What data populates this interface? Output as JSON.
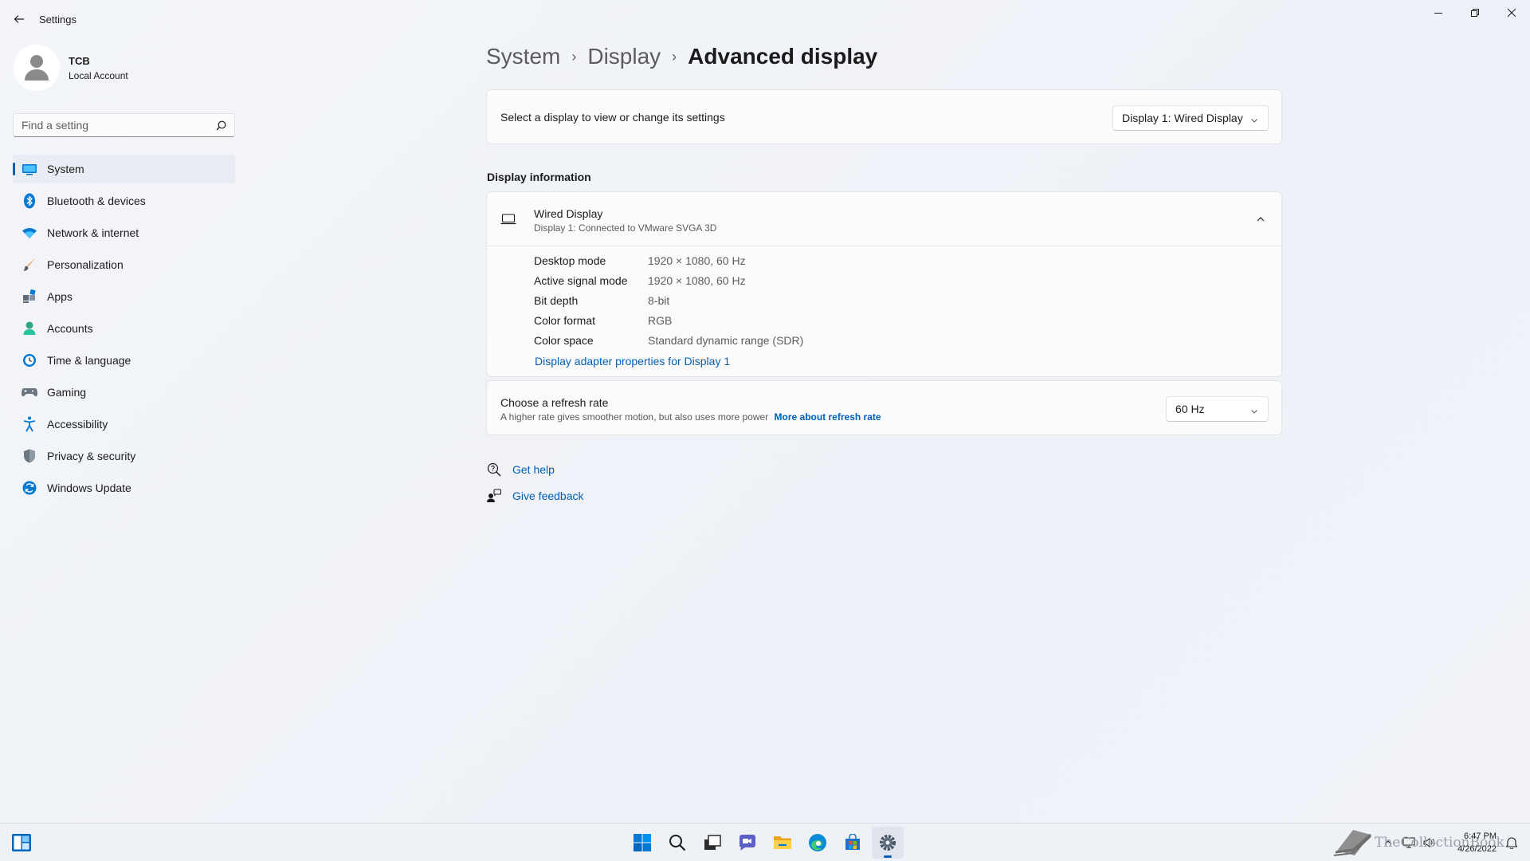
{
  "window": {
    "title": "Settings"
  },
  "profile": {
    "name": "TCB",
    "account_type": "Local Account"
  },
  "search": {
    "placeholder": "Find a setting"
  },
  "sidebar": {
    "items": [
      {
        "label": "System",
        "icon": "monitor-icon",
        "active": true
      },
      {
        "label": "Bluetooth & devices",
        "icon": "bluetooth-icon"
      },
      {
        "label": "Network & internet",
        "icon": "wifi-icon"
      },
      {
        "label": "Personalization",
        "icon": "paintbrush-icon"
      },
      {
        "label": "Apps",
        "icon": "apps-icon"
      },
      {
        "label": "Accounts",
        "icon": "person-icon"
      },
      {
        "label": "Time & language",
        "icon": "globe-clock-icon"
      },
      {
        "label": "Gaming",
        "icon": "gamepad-icon"
      },
      {
        "label": "Accessibility",
        "icon": "accessibility-icon"
      },
      {
        "label": "Privacy & security",
        "icon": "shield-icon"
      },
      {
        "label": "Windows Update",
        "icon": "update-icon"
      }
    ]
  },
  "breadcrumb": {
    "items": [
      "System",
      "Display"
    ],
    "current": "Advanced display"
  },
  "display_select": {
    "label": "Select a display to view or change its settings",
    "selected": "Display 1: Wired Display"
  },
  "display_info": {
    "section_title": "Display information",
    "title": "Wired Display",
    "subtitle": "Display 1: Connected to VMware SVGA 3D",
    "rows": [
      {
        "key": "Desktop mode",
        "value": "1920 × 1080, 60 Hz"
      },
      {
        "key": "Active signal mode",
        "value": "1920 × 1080, 60 Hz"
      },
      {
        "key": "Bit depth",
        "value": "8-bit"
      },
      {
        "key": "Color format",
        "value": "RGB"
      },
      {
        "key": "Color space",
        "value": "Standard dynamic range (SDR)"
      }
    ],
    "adapter_link": "Display adapter properties for Display 1"
  },
  "refresh_rate": {
    "title": "Choose a refresh rate",
    "description": "A higher rate gives smoother motion, but also uses more power",
    "link": "More about refresh rate",
    "selected": "60 Hz"
  },
  "help": {
    "get_help": "Get help",
    "give_feedback": "Give feedback"
  },
  "taskbar": {
    "apps": [
      "start-icon",
      "search-icon",
      "task-view-icon",
      "chat-icon",
      "file-explorer-icon",
      "edge-icon",
      "store-icon",
      "settings-icon"
    ],
    "watermark": "TheCollectionBook",
    "time": "6:47 PM",
    "date": "4/26/2022"
  },
  "colors": {
    "accent": "#005fb8",
    "background": "#f3f5f9",
    "card": "#fbfbfc"
  }
}
